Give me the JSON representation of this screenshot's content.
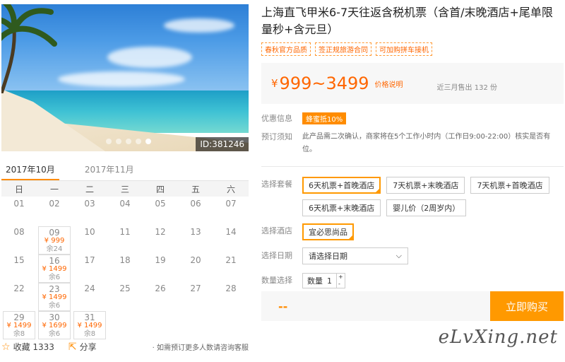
{
  "hero": {
    "id_label": "ID:381246",
    "slides": 5,
    "active_slide": 5
  },
  "calendar": {
    "months": [
      "2017年10月",
      "2017年11月"
    ],
    "weekdays": [
      "日",
      "一",
      "二",
      "三",
      "四",
      "五",
      "六"
    ],
    "weeks": [
      [
        {
          "d": "01"
        },
        {
          "d": "02"
        },
        {
          "d": "03"
        },
        {
          "d": "04"
        },
        {
          "d": "05"
        },
        {
          "d": "06"
        },
        {
          "d": "07"
        }
      ],
      [
        {
          "d": "08"
        },
        {
          "d": "09",
          "p": "¥ 999",
          "r": "余24"
        },
        {
          "d": "10"
        },
        {
          "d": "11"
        },
        {
          "d": "12"
        },
        {
          "d": "13"
        },
        {
          "d": "14"
        }
      ],
      [
        {
          "d": "15"
        },
        {
          "d": "16",
          "p": "¥ 1499",
          "r": "余6"
        },
        {
          "d": "17"
        },
        {
          "d": "18"
        },
        {
          "d": "19"
        },
        {
          "d": "20"
        },
        {
          "d": "21"
        }
      ],
      [
        {
          "d": "22"
        },
        {
          "d": "23",
          "p": "¥ 1499",
          "r": "余6"
        },
        {
          "d": "24"
        },
        {
          "d": "25"
        },
        {
          "d": "26"
        },
        {
          "d": "27"
        },
        {
          "d": "28"
        }
      ],
      [
        {
          "d": "29",
          "p": "¥ 1499",
          "r": "余8"
        },
        {
          "d": "30",
          "p": "¥ 1699",
          "r": "余6"
        },
        {
          "d": "31",
          "p": "¥ 1499",
          "r": "余8"
        },
        {
          "d": ""
        },
        {
          "d": ""
        },
        {
          "d": ""
        },
        {
          "d": ""
        }
      ]
    ]
  },
  "bottom": {
    "favorite": "收藏 1333",
    "share": "分享",
    "note": "· 如需预订更多人数请咨询客服"
  },
  "product": {
    "title": "上海直飞甲米6-7天往返含税机票（含首/末晚酒店+尾单限量秒+含元旦）",
    "tags": [
      "春秋官方品质",
      "签正规旅游合同",
      "可加购拼车接机"
    ],
    "price_currency": "¥",
    "price_range": "999~3499",
    "price_note": "价格说明",
    "sold": "近三月售出 132 份"
  },
  "offers": {
    "label": "优惠信息",
    "badge": "蜂蜜抵10%",
    "notice_label": "预订须知",
    "notice_text": "此产品需二次确认，商家将在5个工作小时内（工作日9:00-22:00）核实是否有位。"
  },
  "options": {
    "package_label": "选择套餐",
    "packages": [
      "6天机票+首晚酒店",
      "7天机票+末晚酒店",
      "7天机票+首晚酒店",
      "6天机票+末晚酒店",
      "婴儿价（2周岁内）"
    ],
    "selected_package": 0,
    "hotel_label": "选择酒店",
    "hotel": "宜必思尚品",
    "date_label": "选择日期",
    "date_placeholder": "请选择日期",
    "qty_label": "数量选择",
    "qty_field_label": "数量",
    "qty_value": "1",
    "qty_up": "+",
    "qty_down": "-"
  },
  "buy": {
    "total": "--",
    "button": "立即购买"
  },
  "watermark": "eLvXing.net",
  "colors": {
    "accent": "#ff9900",
    "price": "#ff6600"
  }
}
